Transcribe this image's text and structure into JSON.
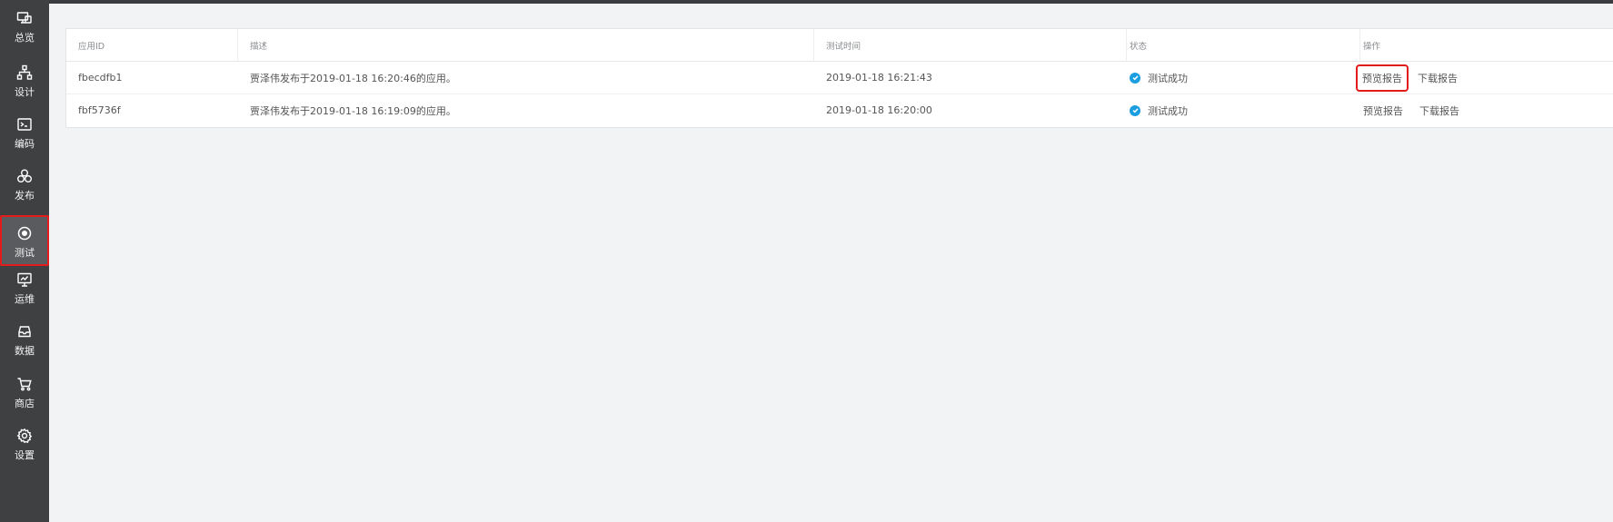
{
  "sidebar": {
    "items": [
      {
        "label": "总览",
        "icon": "monitor-icon"
      },
      {
        "label": "设计",
        "icon": "sitemap-icon"
      },
      {
        "label": "编码",
        "icon": "terminal-icon"
      },
      {
        "label": "发布",
        "icon": "circles-icon"
      },
      {
        "label": "测试",
        "icon": "target-icon",
        "active": true
      },
      {
        "label": "运维",
        "icon": "monitor-chart-icon"
      },
      {
        "label": "数据",
        "icon": "database-icon"
      },
      {
        "label": "商店",
        "icon": "cart-icon"
      },
      {
        "label": "设置",
        "icon": "gear-icon"
      }
    ]
  },
  "table": {
    "headers": {
      "app_id": "应用ID",
      "description": "描述",
      "test_time": "测试时间",
      "status": "状态",
      "actions": "操作"
    },
    "rows": [
      {
        "app_id": "fbecdfb1",
        "description": "贾泽伟发布于2019-01-18 16:20:46的应用。",
        "test_time": "2019-01-18 16:21:43",
        "status": "测试成功",
        "preview": "预览报告",
        "download": "下载报告"
      },
      {
        "app_id": "fbf5736f",
        "description": "贾泽伟发布于2019-01-18 16:19:09的应用。",
        "test_time": "2019-01-18 16:20:00",
        "status": "测试成功",
        "preview": "预览报告",
        "download": "下载报告"
      }
    ]
  },
  "colors": {
    "sidebar_bg": "#3f4042",
    "highlight": "#e31b1b",
    "status_success": "#1b9ee0"
  }
}
